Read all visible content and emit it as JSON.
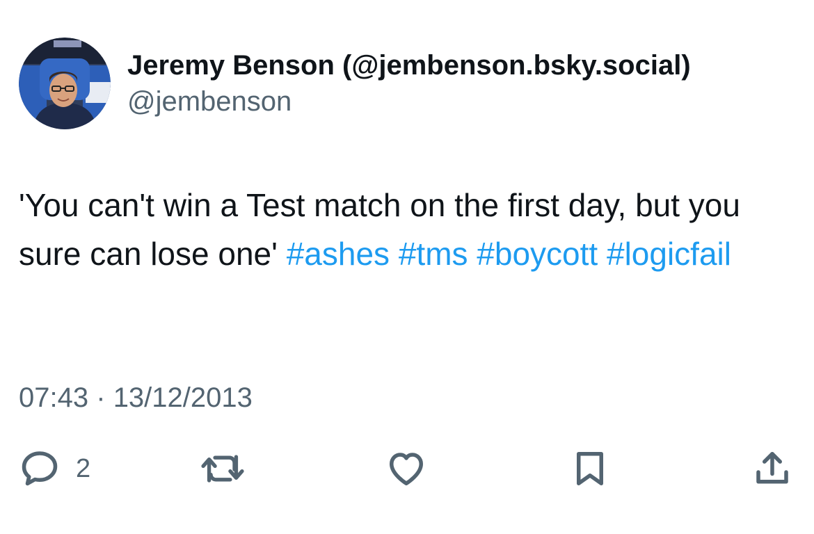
{
  "author": {
    "display_name": "Jeremy Benson (@jembenson.bsky.social)",
    "handle": "@jembenson",
    "avatar_icon": "profile-photo"
  },
  "tweet": {
    "text_parts": [
      "'You can't win a Test match on the first day, but you sure can lose one'",
      "#ashes",
      "#tms",
      "#boycott",
      "#logicfail"
    ],
    "time": "07:43",
    "separator": "·",
    "date": "13/12/2013"
  },
  "actions": {
    "reply_icon": "reply-icon",
    "reply_count": "2",
    "retweet_icon": "retweet-icon",
    "like_icon": "heart-icon",
    "bookmark_icon": "bookmark-icon",
    "share_icon": "share-icon"
  },
  "colors": {
    "text": "#0f1419",
    "secondary": "#536471",
    "link": "#1d9bf0",
    "background": "#ffffff"
  }
}
